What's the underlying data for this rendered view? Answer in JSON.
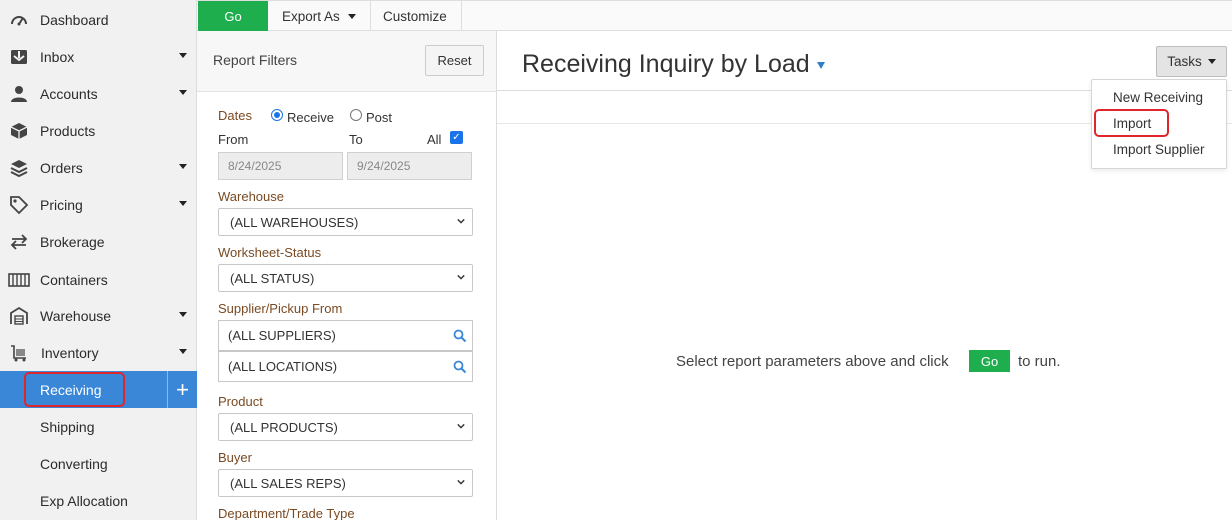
{
  "sidebar": {
    "items": [
      {
        "label": "Dashboard",
        "icon": "dashboard-icon",
        "has_caret": false
      },
      {
        "label": "Inbox",
        "icon": "inbox-icon",
        "has_caret": true
      },
      {
        "label": "Accounts",
        "icon": "user-icon",
        "has_caret": true
      },
      {
        "label": "Products",
        "icon": "box-icon",
        "has_caret": false
      },
      {
        "label": "Orders",
        "icon": "layers-icon",
        "has_caret": true
      },
      {
        "label": "Pricing",
        "icon": "tag-icon",
        "has_caret": true
      },
      {
        "label": "Brokerage",
        "icon": "swap-arrows-icon",
        "has_caret": false
      },
      {
        "label": "Containers",
        "icon": "container-icon",
        "has_caret": false
      },
      {
        "label": "Warehouse",
        "icon": "warehouse-icon",
        "has_caret": true
      },
      {
        "label": "Inventory",
        "icon": "cart-icon",
        "has_caret": true
      }
    ],
    "sub_items": [
      {
        "label": "Receiving",
        "active": true
      },
      {
        "label": "Shipping",
        "active": false
      },
      {
        "label": "Converting",
        "active": false
      },
      {
        "label": "Exp Allocation",
        "active": false
      }
    ],
    "active_color": "#3a87d8"
  },
  "toolbar": {
    "go_label": "Go",
    "export_label": "Export As",
    "customize_label": "Customize",
    "go_color": "#1eae4e"
  },
  "filters": {
    "title": "Report Filters",
    "reset_label": "Reset",
    "dates": {
      "label": "Dates",
      "receive_label": "Receive",
      "post_label": "Post",
      "selected": "Receive",
      "from_label": "From",
      "to_label": "To",
      "all_label": "All",
      "all_checked": true,
      "from_value": "8/24/2025",
      "to_value": "9/24/2025"
    },
    "warehouse": {
      "label": "Warehouse",
      "value": "(ALL WAREHOUSES)"
    },
    "worksheet_status": {
      "label": "Worksheet-Status",
      "value": "(ALL STATUS)"
    },
    "supplier": {
      "label": "Supplier/Pickup From",
      "supplier_value": "(ALL SUPPLIERS)",
      "location_value": "(ALL LOCATIONS)"
    },
    "product": {
      "label": "Product",
      "value": "(ALL PRODUCTS)"
    },
    "buyer": {
      "label": "Buyer",
      "value": "(ALL SALES REPS)"
    },
    "department": {
      "label": "Department/Trade Type"
    }
  },
  "main": {
    "title": "Receiving Inquiry by Load",
    "tasks_label": "Tasks",
    "tasks_menu": [
      "New Receiving",
      "Import",
      "Import Supplier"
    ],
    "empty_message_prefix": "Select report parameters above and click",
    "empty_message_go": "Go",
    "empty_message_suffix": "to run."
  }
}
